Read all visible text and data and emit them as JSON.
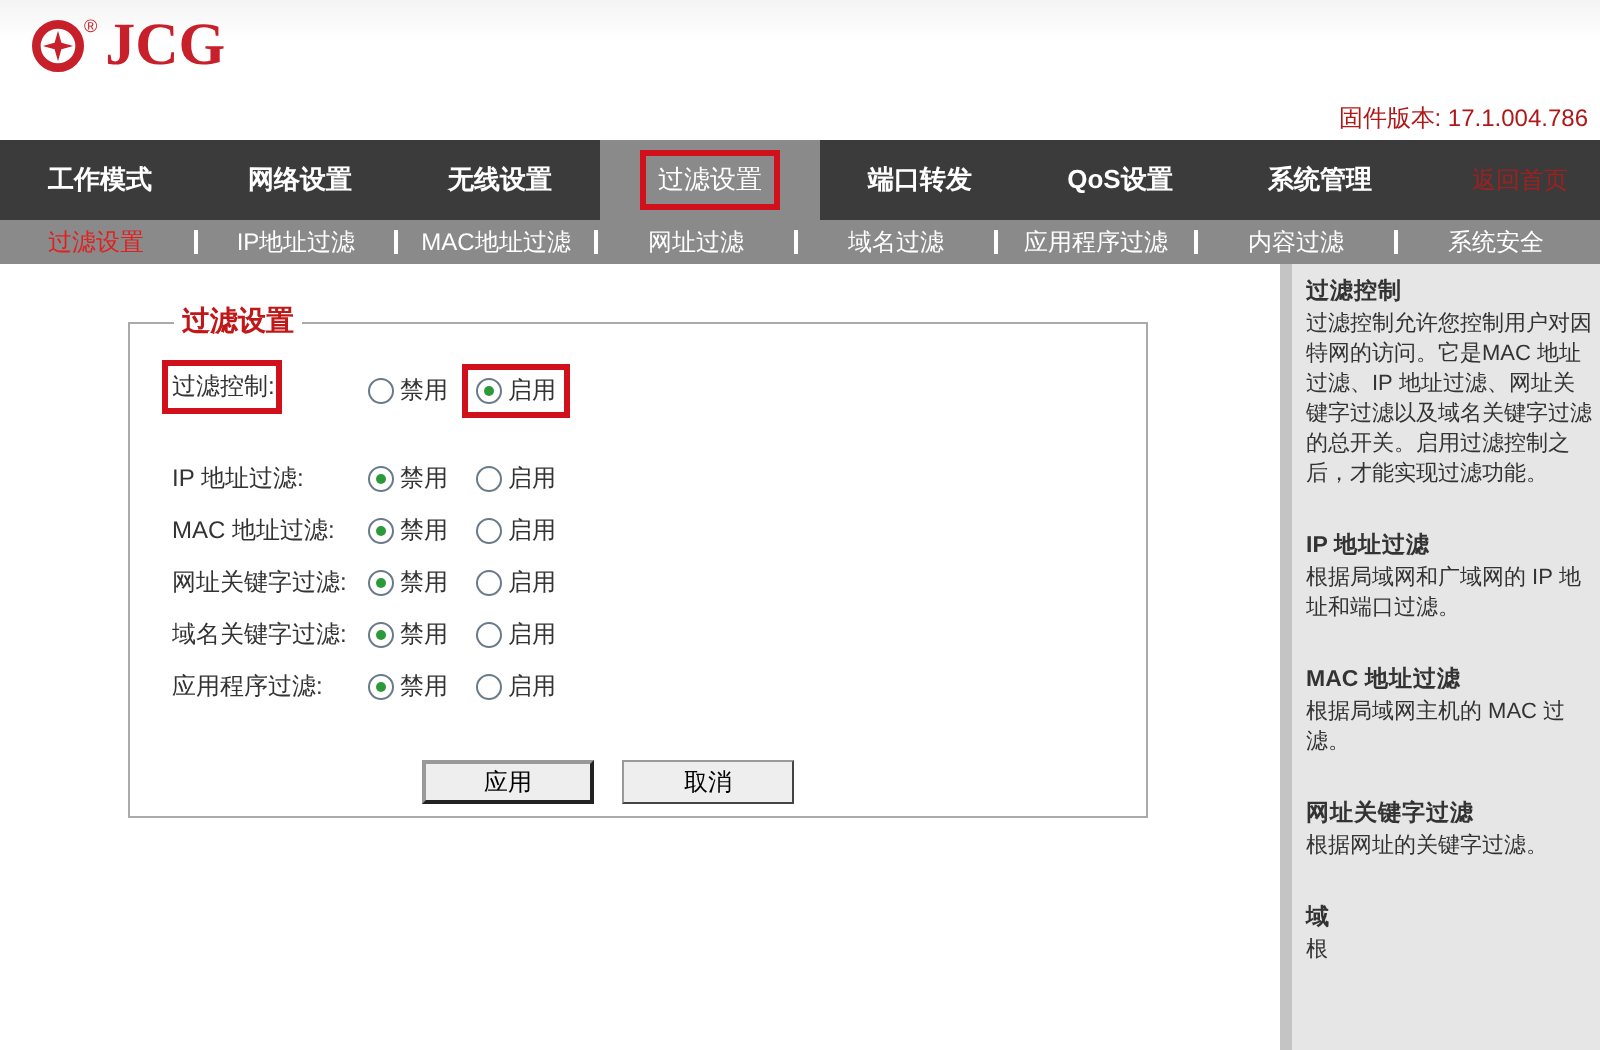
{
  "header": {
    "logo_text": "JCG",
    "logo_mark": "®",
    "firmware": "固件版本: 17.1.004.786"
  },
  "nav": {
    "items": [
      {
        "label": "工作模式",
        "selected": false,
        "highlighted": false
      },
      {
        "label": "网络设置",
        "selected": false,
        "highlighted": false
      },
      {
        "label": "无线设置",
        "selected": false,
        "highlighted": false
      },
      {
        "label": "过滤设置",
        "selected": true,
        "highlighted": true
      },
      {
        "label": "端口转发",
        "selected": false,
        "highlighted": false
      },
      {
        "label": "QoS设置",
        "selected": false,
        "highlighted": false
      },
      {
        "label": "系统管理",
        "selected": false,
        "highlighted": false
      }
    ],
    "home_link": "返回首页"
  },
  "subnav": [
    {
      "label": "过滤设置",
      "selected": true
    },
    {
      "label": "IP地址过滤",
      "selected": false
    },
    {
      "label": "MAC地址过滤",
      "selected": false
    },
    {
      "label": "网址过滤",
      "selected": false
    },
    {
      "label": "域名过滤",
      "selected": false
    },
    {
      "label": "应用程序过滤",
      "selected": false
    },
    {
      "label": "内容过滤",
      "selected": false
    },
    {
      "label": "系统安全",
      "selected": false
    }
  ],
  "panel": {
    "title": "过滤设置",
    "rows": [
      {
        "label": "过滤控制:",
        "highlighted": true,
        "options": [
          {
            "label": "禁用",
            "selected": false,
            "highlighted": false
          },
          {
            "label": "启用",
            "selected": true,
            "highlighted": true
          }
        ]
      },
      {
        "label": "IP 地址过滤:",
        "highlighted": false,
        "options": [
          {
            "label": "禁用",
            "selected": true,
            "highlighted": false
          },
          {
            "label": "启用",
            "selected": false,
            "highlighted": false
          }
        ]
      },
      {
        "label": "MAC 地址过滤:",
        "highlighted": false,
        "options": [
          {
            "label": "禁用",
            "selected": true,
            "highlighted": false
          },
          {
            "label": "启用",
            "selected": false,
            "highlighted": false
          }
        ]
      },
      {
        "label": "网址关键字过滤:",
        "highlighted": false,
        "options": [
          {
            "label": "禁用",
            "selected": true,
            "highlighted": false
          },
          {
            "label": "启用",
            "selected": false,
            "highlighted": false
          }
        ]
      },
      {
        "label": "域名关键字过滤:",
        "highlighted": false,
        "options": [
          {
            "label": "禁用",
            "selected": true,
            "highlighted": false
          },
          {
            "label": "启用",
            "selected": false,
            "highlighted": false
          }
        ]
      },
      {
        "label": "应用程序过滤:",
        "highlighted": false,
        "options": [
          {
            "label": "禁用",
            "selected": true,
            "highlighted": false
          },
          {
            "label": "启用",
            "selected": false,
            "highlighted": false
          }
        ]
      }
    ],
    "buttons": [
      "应用",
      "取消"
    ]
  },
  "help": [
    {
      "title": "过滤控制",
      "text": "过滤控制允许您控制用户对因特网的访问。它是MAC 地址过滤、IP 地址过滤、网址关键字过滤以及域名关键字过滤的总开关。启用过滤控制之后，才能实现过滤功能。"
    },
    {
      "title": "IP 地址过滤",
      "text": "根据局域网和广域网的 IP 地址和端口过滤。"
    },
    {
      "title": "MAC 地址过滤",
      "text": "根据局域网主机的 MAC 过滤。"
    },
    {
      "title": "网址关键字过滤",
      "text": "根据网址的关键字过滤。"
    },
    {
      "title": "域",
      "text": "根"
    }
  ]
}
